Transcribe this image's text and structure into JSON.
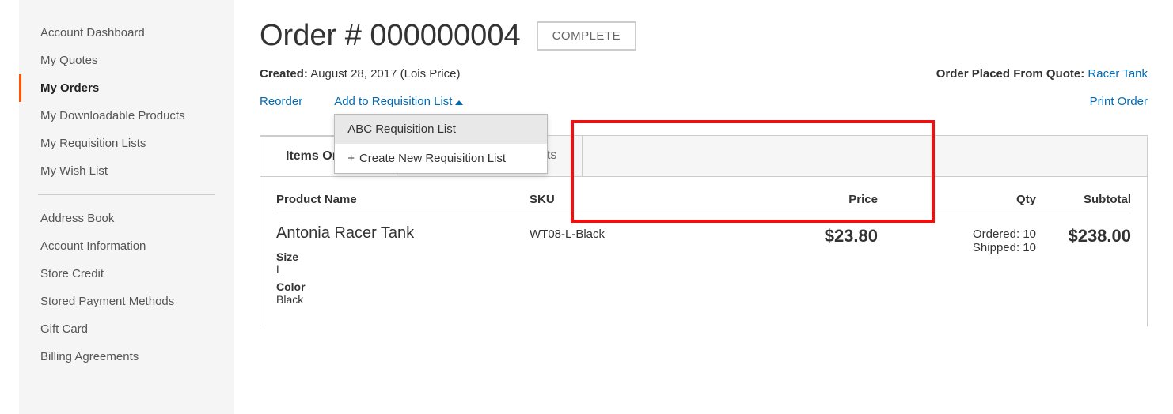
{
  "sidebar": {
    "items": [
      {
        "label": "Account Dashboard",
        "name": "sidebar-item-dashboard"
      },
      {
        "label": "My Quotes",
        "name": "sidebar-item-quotes"
      },
      {
        "label": "My Orders",
        "name": "sidebar-item-orders"
      },
      {
        "label": "My Downloadable Products",
        "name": "sidebar-item-downloadable"
      },
      {
        "label": "My Requisition Lists",
        "name": "sidebar-item-requisition"
      },
      {
        "label": "My Wish List",
        "name": "sidebar-item-wishlist"
      }
    ],
    "items2": [
      {
        "label": "Address Book",
        "name": "sidebar-item-address"
      },
      {
        "label": "Account Information",
        "name": "sidebar-item-account-info"
      },
      {
        "label": "Store Credit",
        "name": "sidebar-item-store-credit"
      },
      {
        "label": "Stored Payment Methods",
        "name": "sidebar-item-payment"
      },
      {
        "label": "Gift Card",
        "name": "sidebar-item-gift"
      },
      {
        "label": "Billing Agreements",
        "name": "sidebar-item-billing"
      }
    ],
    "active_index": 2
  },
  "order": {
    "title": "Order # 000000004",
    "status": "COMPLETE",
    "created_label": "Created:",
    "created_value": " August 28, 2017 (Lois Price)",
    "placed_label": "Order Placed From Quote: ",
    "placed_link": "Racer Tank"
  },
  "actions": {
    "reorder": "Reorder",
    "add_req": "Add to Requisition List",
    "print": "Print Order",
    "dropdown": [
      {
        "label": "ABC Requisition List",
        "highlight": true,
        "name": "req-item-abc"
      },
      {
        "label": "Create New Requisition List",
        "plus": true,
        "name": "req-item-create"
      }
    ]
  },
  "tabs": {
    "items": [
      {
        "label": "Items Ordered",
        "name": "tab-items-ordered"
      },
      {
        "label": "Order Shipments",
        "name": "tab-shipments"
      }
    ],
    "active_index": 0
  },
  "table": {
    "headers": {
      "product": "Product Name",
      "sku": "SKU",
      "price": "Price",
      "qty": "Qty",
      "subtotal": "Subtotal"
    },
    "rows": [
      {
        "product_name": "Antonia Racer Tank",
        "sku": "WT08-L-Black",
        "price": "$23.80",
        "qty_ordered": "Ordered: 10",
        "qty_shipped": "Shipped: 10",
        "subtotal": "$238.00",
        "attrs": [
          {
            "label": "Size",
            "value": "L"
          },
          {
            "label": "Color",
            "value": "Black"
          }
        ]
      }
    ]
  }
}
